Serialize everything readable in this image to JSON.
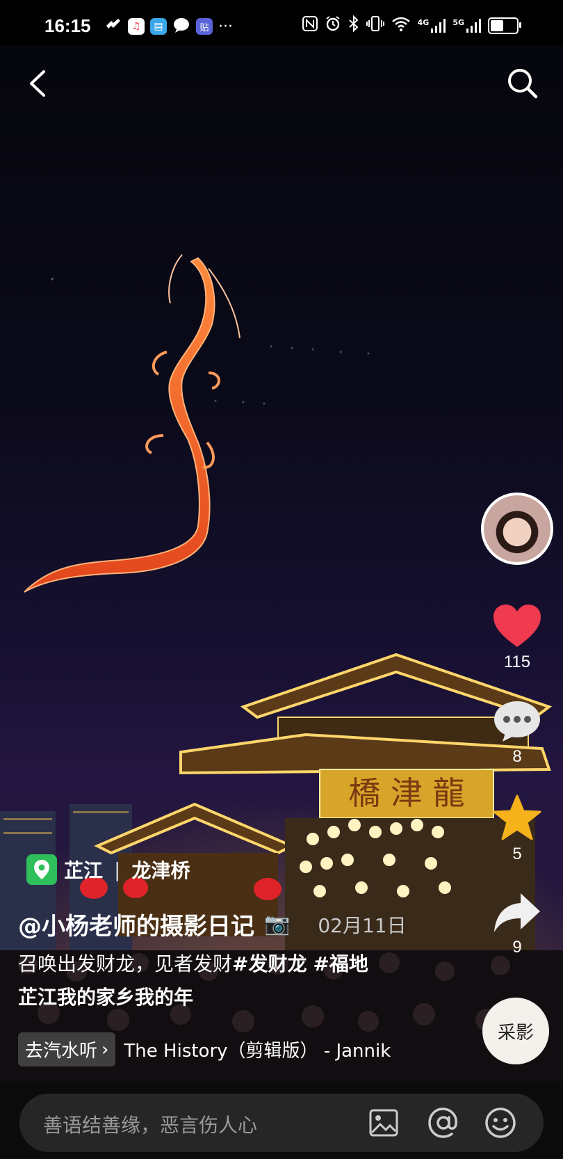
{
  "status": {
    "time": "16:15",
    "network_4g": "4G",
    "network_5g": "5G",
    "battery_level": 0.55,
    "more": "···"
  },
  "post": {
    "location_city": "芷江",
    "location_place": "龙津桥",
    "author": "@小杨老师的摄影日记",
    "date": "02月11日",
    "caption_text": "召唤出发财龙，见者发财",
    "tag1": "#发财龙",
    "tag2": "#福地",
    "caption_line2": "芷江我的家乡我的年"
  },
  "actions": {
    "likes": "115",
    "comments": "8",
    "favorites": "5",
    "shares": "9"
  },
  "music": {
    "button_label": "去汽水听",
    "title": "The History（剪辑版） - Jannik"
  },
  "comment_input": {
    "placeholder": "善语结善缘，恶言伤人心"
  },
  "colors": {
    "like": "#f03a4f",
    "favorite": "#f5b21a",
    "location_pin": "#2fbf5b"
  }
}
